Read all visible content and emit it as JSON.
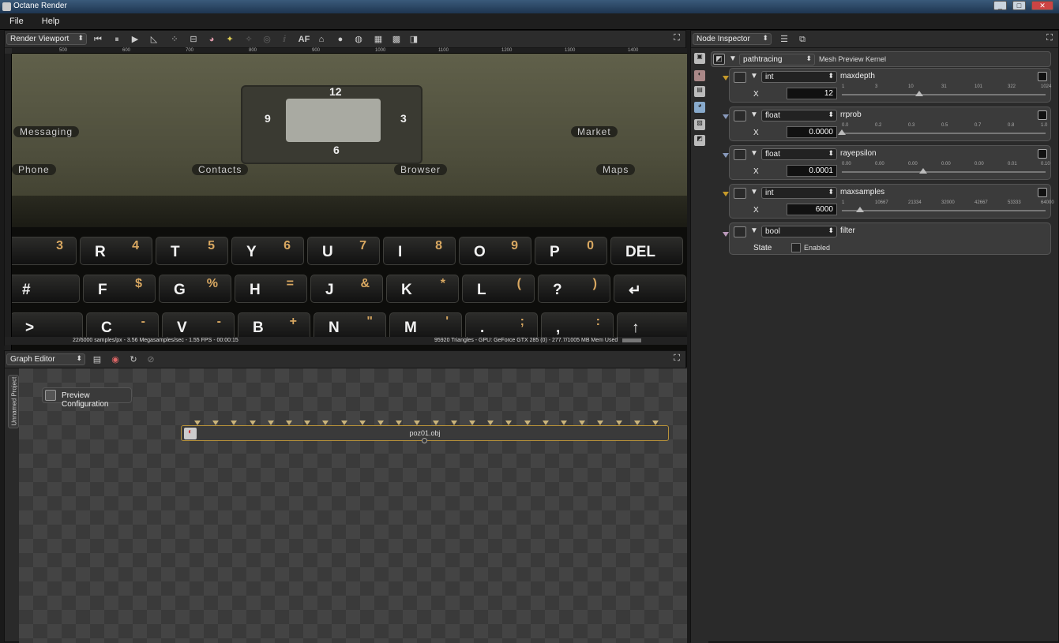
{
  "window": {
    "title": "Octane Render",
    "minimize": "_",
    "maximize": "□",
    "close": "✕"
  },
  "menu": [
    "File",
    "Help"
  ],
  "viewport": {
    "dropdown": "Render Viewport",
    "af_label": "AF",
    "ruler_ticks": [
      "500",
      "600",
      "700",
      "800",
      "900",
      "1000",
      "1100",
      "1200",
      "1300",
      "1400"
    ],
    "scene": {
      "clock": [
        "12",
        "9",
        "3",
        "6"
      ],
      "apps": [
        "Messaging",
        "Contacts",
        "Browser",
        "Market",
        "Maps",
        "Phone"
      ],
      "key_rows": [
        [
          {
            "a": "",
            "b": "3"
          },
          {
            "a": "R",
            "b": "4"
          },
          {
            "a": "T",
            "b": "5"
          },
          {
            "a": "Y",
            "b": "6"
          },
          {
            "a": "U",
            "b": "7"
          },
          {
            "a": "I",
            "b": "8"
          },
          {
            "a": "O",
            "b": "9"
          },
          {
            "a": "P",
            "b": "0"
          },
          {
            "a": "DEL",
            "b": ""
          }
        ],
        [
          {
            "a": "#",
            "b": ""
          },
          {
            "a": "F",
            "b": "$"
          },
          {
            "a": "G",
            "b": "%"
          },
          {
            "a": "H",
            "b": "="
          },
          {
            "a": "J",
            "b": "&"
          },
          {
            "a": "K",
            "b": "*"
          },
          {
            "a": "L",
            "b": "("
          },
          {
            "a": "?",
            "b": ")"
          },
          {
            "a": "↵",
            "b": ""
          }
        ],
        [
          {
            "a": ">",
            "b": ""
          },
          {
            "a": "C",
            "b": "-"
          },
          {
            "a": "V",
            "b": "-"
          },
          {
            "a": "B",
            "b": "+"
          },
          {
            "a": "N",
            "b": "\""
          },
          {
            "a": "M",
            "b": "'"
          },
          {
            "a": ".",
            "b": ";"
          },
          {
            "a": ",",
            "b": ":"
          },
          {
            "a": "↑",
            "b": ""
          }
        ]
      ]
    },
    "status_left": "22/6000 samples/px - 3.56 Megasamples/sec - 1.55 FPS - 00:00:15",
    "status_right": "95920 Triangles - GPU: GeForce GTX 285 (0) - 277.7/1005 MB Mem Used"
  },
  "graph": {
    "dropdown": "Graph Editor",
    "project_tab": "Unnamed Project",
    "preview_node": "Preview Configuration",
    "obj_node": "poz01.obj"
  },
  "inspector": {
    "dropdown": "Node Inspector",
    "kernel": {
      "value": "pathtracing",
      "label": "Mesh Preview Kernel"
    },
    "params": [
      {
        "type": "int",
        "name": "maxdepth",
        "axis": "X",
        "value": "12",
        "ticks": [
          "1",
          "3",
          "10",
          "31",
          "101",
          "322",
          "1024"
        ],
        "level": 0.38
      },
      {
        "type": "float",
        "name": "rrprob",
        "axis": "X",
        "value": "0.0000",
        "ticks": [
          "0.0",
          "0.2",
          "0.3",
          "0.5",
          "0.7",
          "0.8",
          "1.0"
        ],
        "level": 0.0
      },
      {
        "type": "float",
        "name": "rayepsilon",
        "axis": "X",
        "value": "0.0001",
        "ticks": [
          "0.00",
          "0.00",
          "0.00",
          "0.00",
          "0.00",
          "0.01",
          "0.10"
        ],
        "level": 0.4
      },
      {
        "type": "int",
        "name": "maxsamples",
        "axis": "X",
        "value": "6000",
        "ticks": [
          "1",
          "10667",
          "21334",
          "32000",
          "42667",
          "53333",
          "64000"
        ],
        "level": 0.09
      }
    ],
    "filter": {
      "type": "bool",
      "name": "filter",
      "state_label": "State",
      "checkbox_label": "Enabled"
    }
  }
}
